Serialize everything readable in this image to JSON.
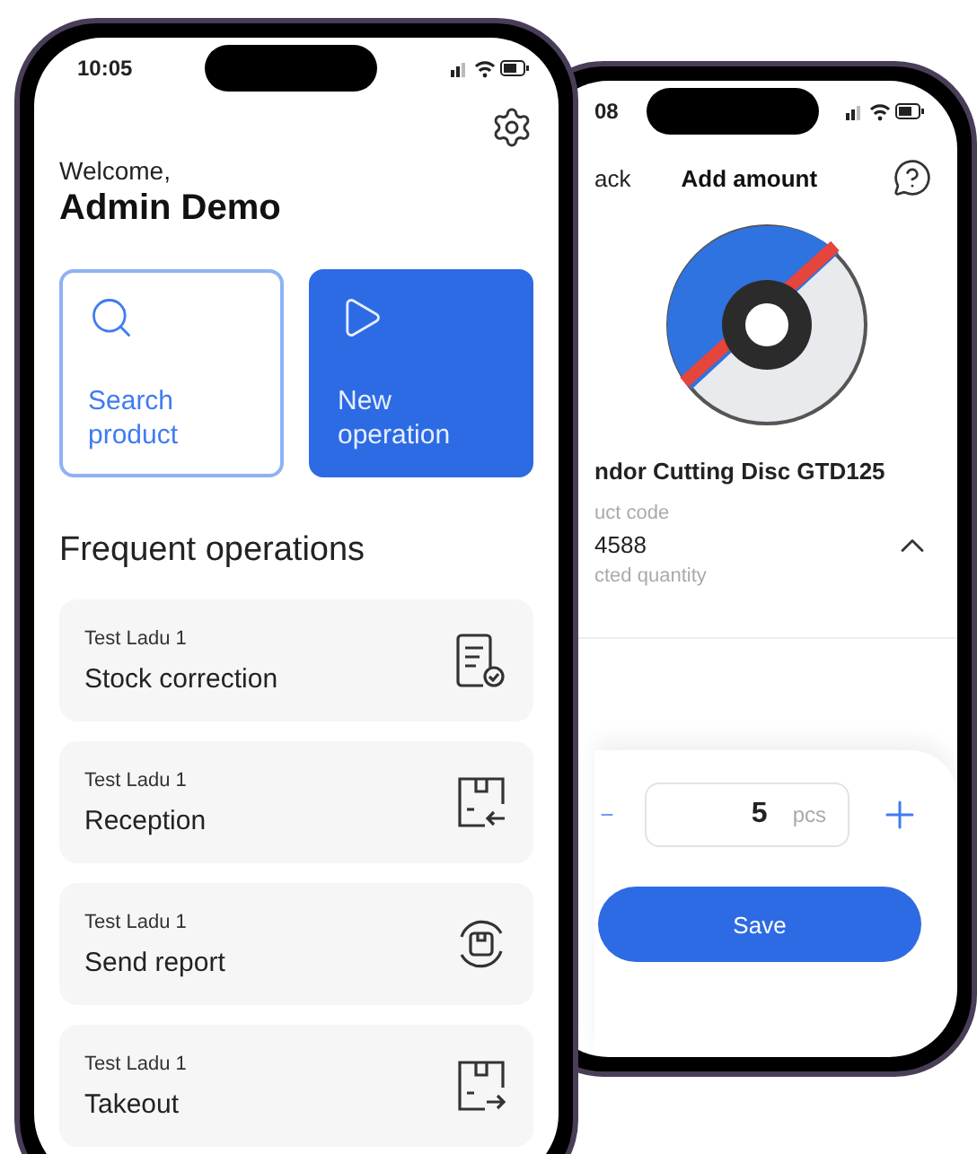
{
  "home_screen": {
    "status_time": "10:05",
    "welcome": "Welcome,",
    "user_name": "Admin Demo",
    "actions": [
      {
        "label": "Search product",
        "kind": "search"
      },
      {
        "label": "New operation",
        "kind": "start"
      }
    ],
    "section_title": "Frequent operations",
    "operations": [
      {
        "warehouse": "Test Ladu 1",
        "name": "Stock correction",
        "kind": "correction"
      },
      {
        "warehouse": "Test Ladu 1",
        "name": "Reception",
        "kind": "reception"
      },
      {
        "warehouse": "Test Ladu 1",
        "name": "Send report",
        "kind": "report"
      },
      {
        "warehouse": "Test Ladu 1",
        "name": "Takeout",
        "kind": "takeout"
      }
    ]
  },
  "amount_screen": {
    "status_time": "08",
    "back_label": "ack",
    "title": "Add amount",
    "product_name": "ndor Cutting Disc GTD125",
    "code_label": "uct code",
    "code_value": "4588",
    "quantity_label": "cted quantity",
    "details_expanded": true,
    "quantity": "5",
    "unit": "pcs",
    "save_label": "Save"
  }
}
